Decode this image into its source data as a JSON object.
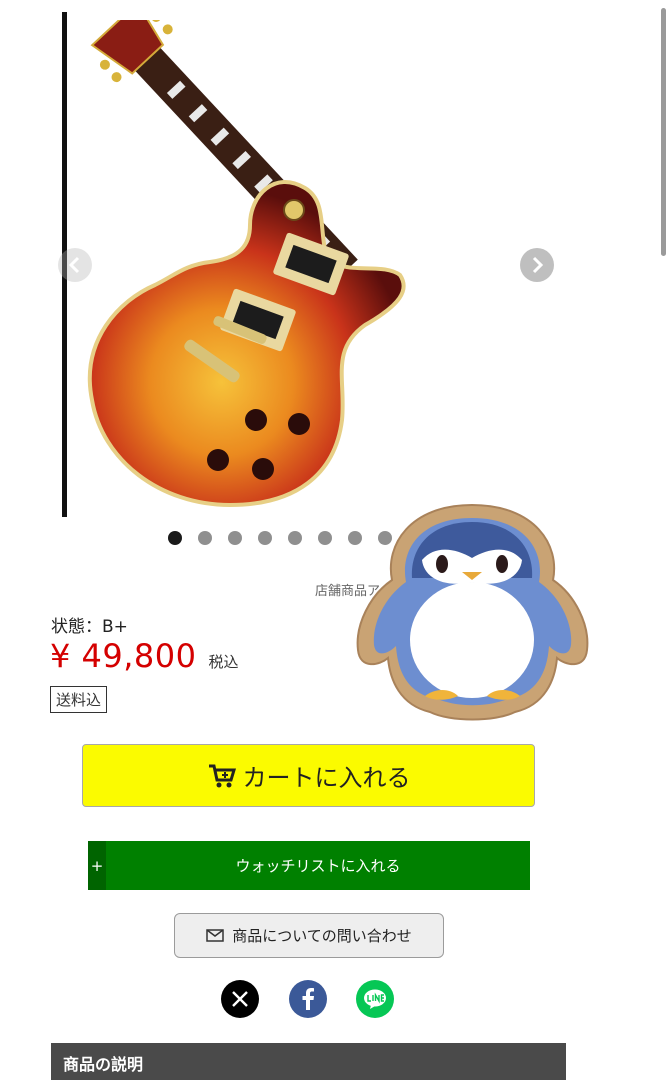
{
  "gallery": {
    "image_alt": "Les Paul style electric guitar, cherry sunburst",
    "prev_icon": "chevron-left-icon",
    "next_icon": "chevron-right-icon",
    "dot_count": 8,
    "active_index": 0
  },
  "store_note": "店舗商品ア",
  "product": {
    "condition": "状態：B+",
    "price": "¥ 49,800",
    "tax_label": "税込",
    "shipping_badge": "送料込"
  },
  "actions": {
    "cart_label": "カートに入れる",
    "cart_icon": "cart-icon",
    "watch_plus": "+",
    "watch_label": "ウォッチリストに入れる",
    "inquiry_label": "商品についての問い合わせ",
    "inquiry_icon": "mail-icon"
  },
  "share": {
    "x_icon": "x-logo-icon",
    "facebook_icon": "facebook-icon",
    "line_icon": "line-icon"
  },
  "description": {
    "header": "商品の説明"
  },
  "colors": {
    "price_red": "#d40000",
    "cart_yellow": "#fbfb00",
    "watch_green": "#008000",
    "line_green": "#06c755",
    "facebook_blue": "#3b5998"
  }
}
